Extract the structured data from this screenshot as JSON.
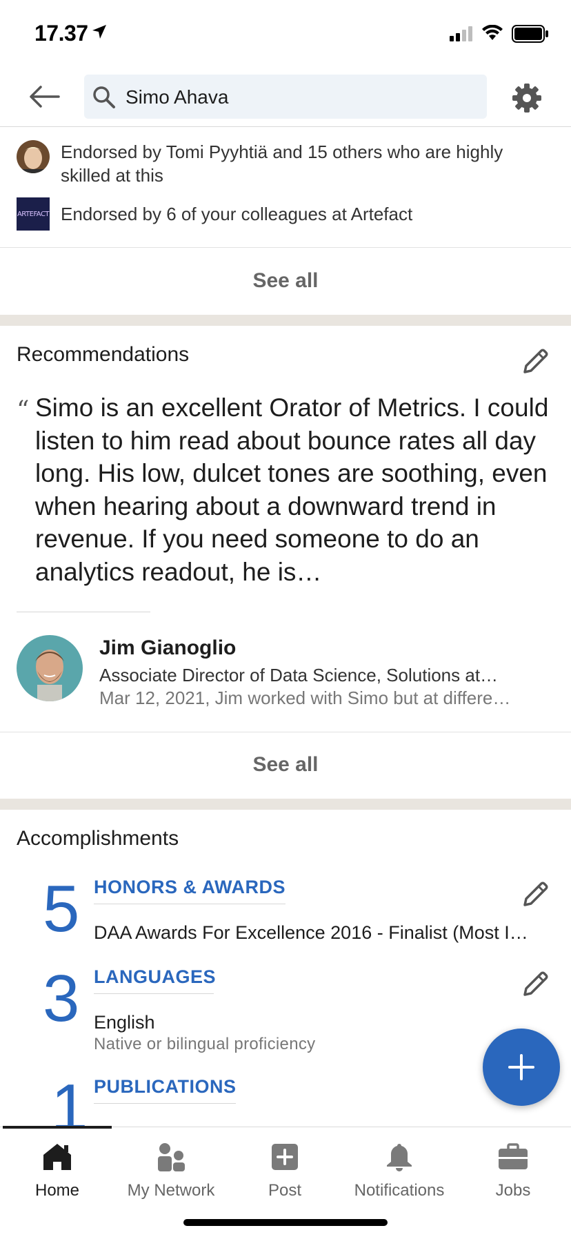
{
  "status_bar": {
    "time": "17.37"
  },
  "search": {
    "query": "Simo Ahava"
  },
  "endorsements": [
    {
      "text": "Endorsed by Tomi Pyyhtiä and 15 others who are highly skilled at this"
    },
    {
      "text": "Endorsed by 6 of your colleagues at Artefact",
      "logo_text": "ARTEFACT"
    }
  ],
  "skills_see_all": "See all",
  "recommendations": {
    "title": "Recommendations",
    "quote_mark": "“",
    "quote": "Simo is an excellent Orator of Metrics. I could listen to him read about bounce rates all day long. His low, dulcet tones are soothing, even when hearing about a downward trend in revenue. If you need someone to do an analytics readout, he is…",
    "recommender_name": "Jim Gianoglio",
    "recommender_title": "Associate Director of Data Science, Solutions at…",
    "recommender_meta": "Mar 12, 2021, Jim worked with Simo but at differe…",
    "see_all": "See all"
  },
  "accomplishments": {
    "title": "Accomplishments",
    "items": [
      {
        "count": "5",
        "category": "HONORS & AWARDS",
        "detail": "DAA Awards For Excellence 2016 - Finalist (Most I…",
        "sub": ""
      },
      {
        "count": "3",
        "category": "LANGUAGES",
        "detail": "English",
        "sub": "Native or bilingual proficiency"
      },
      {
        "count": "1",
        "category": "PUBLICATIONS",
        "detail": "",
        "sub": ""
      }
    ]
  },
  "bottom_nav": {
    "items": [
      {
        "label": "Home",
        "active": true
      },
      {
        "label": "My Network",
        "active": false
      },
      {
        "label": "Post",
        "active": false
      },
      {
        "label": "Notifications",
        "active": false
      },
      {
        "label": "Jobs",
        "active": false
      }
    ]
  },
  "colors": {
    "accent": "#2a67bd",
    "section_gap": "#e9e5df",
    "search_bg": "#eef3f8"
  }
}
